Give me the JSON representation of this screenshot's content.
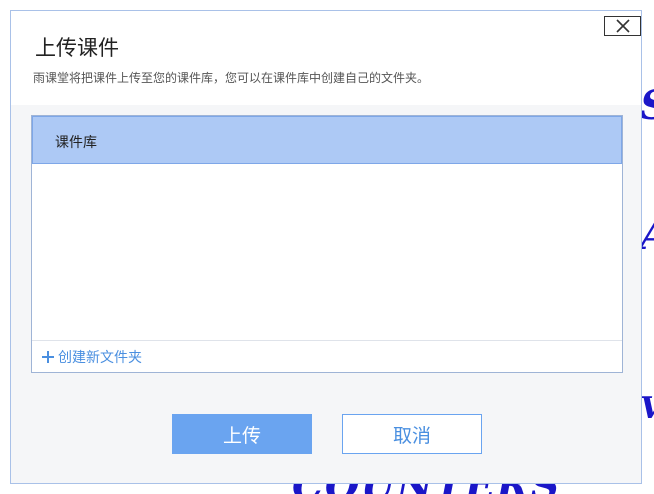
{
  "background": {
    "glimpses": [
      "S",
      "A",
      "V",
      "COUNTERS"
    ]
  },
  "dialog": {
    "title": "上传课件",
    "subtitle": "雨课堂将把课件上传至您的课件库，您可以在课件库中创建自己的文件夹。",
    "close_icon": "close-icon",
    "folders": [
      {
        "label": "课件库",
        "selected": true
      }
    ],
    "new_folder_label": "创建新文件夹",
    "new_folder_icon": "plus-icon",
    "upload_label": "上传",
    "cancel_label": "取消"
  },
  "colors": {
    "accent": "#6aa4f0",
    "selected_row": "#adc9f5",
    "link": "#4a8fe0",
    "background_text": "#1a16c8"
  }
}
